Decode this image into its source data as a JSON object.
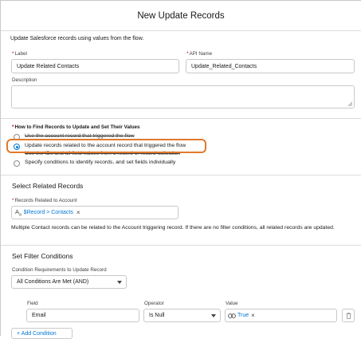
{
  "header": {
    "title": "New Update Records"
  },
  "intro": "Update Salesforce records using values from the flow.",
  "label_field": {
    "label": "Label",
    "value": "Update Related Contacts"
  },
  "api_field": {
    "label": "API Name",
    "value": "Update_Related_Contacts"
  },
  "description_field": {
    "label": "Description",
    "value": ""
  },
  "find_records": {
    "label": "How to Find Records to Update and Set Their Values",
    "options": [
      "Use the account record that triggered the flow",
      "Update records related to the account record that triggered the flow",
      "Use the IDs and all field values from a record or record collection",
      "Specify conditions to identify records, and set fields individually"
    ],
    "selected_index": 1
  },
  "related_section": {
    "title": "Select Related Records",
    "field_label": "Records Related to Account",
    "pill_prefix": "A",
    "pill_sub": "a",
    "pill_value": "$Record > Contacts",
    "remove_glyph": "×",
    "note": "Multiple Contact records can be related to the Account triggering record. If there are no filter conditions, all related records are updated."
  },
  "filter_section": {
    "title": "Set Filter Conditions",
    "requirement_label": "Condition Requirements to Update Record",
    "requirement_value": "All Conditions Are Met (AND)",
    "columns": {
      "field": "Field",
      "operator": "Operator",
      "value": "Value"
    },
    "row": {
      "field": "Email",
      "operator": "Is Null",
      "value": "True",
      "remove_glyph": "×"
    },
    "add_condition": "+ Add Condition"
  },
  "colors": {
    "accent": "#0176d3",
    "highlight": "#e07a2c",
    "required": "#ba0517"
  }
}
